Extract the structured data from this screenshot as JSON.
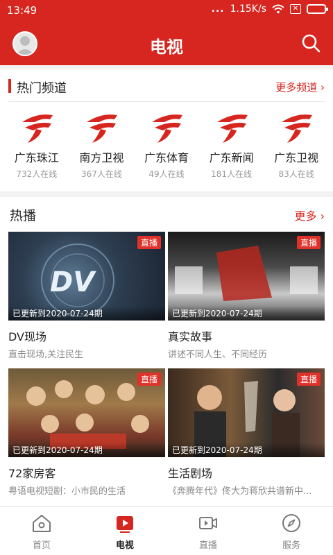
{
  "status_bar": {
    "time": "13:49",
    "dots": "...",
    "speed": "1.15K/s"
  },
  "header": {
    "title": "电视"
  },
  "hot_channels": {
    "title": "热门频道",
    "more": "更多频道 ›",
    "channels": [
      {
        "name": "广东珠江",
        "online": "732人在线"
      },
      {
        "name": "南方卫视",
        "online": "367人在线"
      },
      {
        "name": "广东体育",
        "online": "49人在线"
      },
      {
        "name": "广东新闻",
        "online": "181人在线"
      },
      {
        "name": "广东卫视",
        "online": "83人在线"
      }
    ]
  },
  "hot_shows": {
    "title": "热播",
    "more": "更多 ›",
    "live_label": "直播",
    "items": [
      {
        "title": "DV现场",
        "desc": "直击现场,关注民生",
        "updated": "已更新到2020-07-24期"
      },
      {
        "title": "真实故事",
        "desc": "讲述不同人生、不同经历",
        "updated": "已更新到2020-07-24期"
      },
      {
        "title": "72家房客",
        "desc": "粤语电视短剧：小市民的生活",
        "updated": "已更新到2020-07-24期"
      },
      {
        "title": "生活剧场",
        "desc": "《奔腾年代》佟大为蒋欣共谱新中...",
        "updated": "已更新到2020-07-24期"
      }
    ]
  },
  "tabbar": {
    "tabs": [
      {
        "label": "首页"
      },
      {
        "label": "电视"
      },
      {
        "label": "直播"
      },
      {
        "label": "服务"
      }
    ]
  },
  "colors": {
    "brand": "#d6261f"
  }
}
